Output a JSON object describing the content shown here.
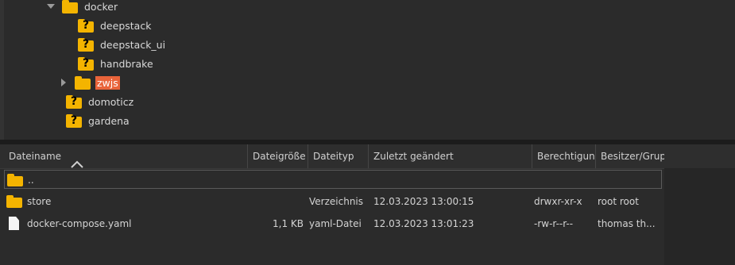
{
  "tree": {
    "nodes": [
      {
        "label": "docker",
        "icon": "folder-icon",
        "expanded": true
      },
      {
        "label": "deepstack",
        "icon": "folder-unknown-icon"
      },
      {
        "label": "deepstack_ui",
        "icon": "folder-unknown-icon"
      },
      {
        "label": "handbrake",
        "icon": "folder-unknown-icon"
      },
      {
        "label": "zwjs",
        "icon": "folder-icon",
        "selected": true,
        "collapsed": true
      },
      {
        "label": "domoticz",
        "icon": "folder-unknown-icon"
      },
      {
        "label": "gardena",
        "icon": "folder-unknown-icon"
      }
    ]
  },
  "list": {
    "columns": {
      "name": "Dateiname",
      "size": "Dateigröße",
      "type": "Dateityp",
      "modified": "Zuletzt geändert",
      "perms": "Berechtigungen",
      "owner": "Besitzer/Gruppe"
    },
    "sort": {
      "column": "name",
      "direction": "ascending",
      "icon": "chevron-up-icon"
    },
    "rows": [
      {
        "name": "..",
        "size": "",
        "type": "",
        "modified": "",
        "perms": "",
        "owner": "",
        "icon": "folder-icon"
      },
      {
        "name": "store",
        "size": "",
        "type": "Verzeichnis",
        "modified": "12.03.2023 13:00:15",
        "perms": "drwxr-xr-x",
        "owner": "root root",
        "icon": "folder-icon"
      },
      {
        "name": "docker-compose.yaml",
        "size": "1,1 KB",
        "type": "yaml-Datei",
        "modified": "12.03.2023 13:01:23",
        "perms": "-rw-r--r--",
        "owner": "thomas th...",
        "icon": "document-icon"
      }
    ]
  },
  "colors": {
    "folder": "#f4b400",
    "selection": "#e9643a",
    "background": "#2b2b2b"
  }
}
